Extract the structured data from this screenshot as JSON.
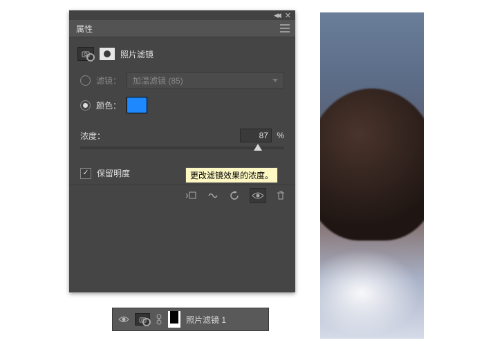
{
  "panel": {
    "title": "属性",
    "section_label": "照片滤镜",
    "filter": {
      "label": "滤镜：",
      "dropdown_value": "加温滤镜 (85)"
    },
    "color": {
      "label": "颜色：",
      "swatch": "#1e88ff"
    },
    "density": {
      "label": "浓度：",
      "value": "87",
      "unit": "%",
      "percent": 87
    },
    "preserve_luminosity": {
      "label": "保留明度",
      "checked": true
    },
    "tooltip": "更改滤镜效果的浓度。"
  },
  "layer": {
    "label": "照片滤镜 1"
  }
}
